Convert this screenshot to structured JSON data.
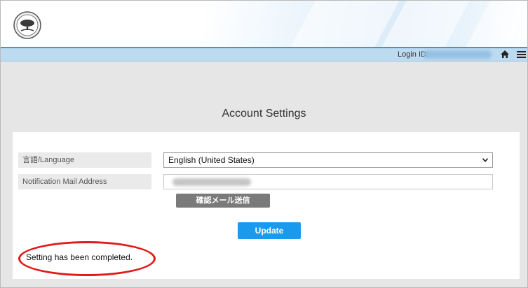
{
  "header": {
    "login_label": "Login ID:"
  },
  "page": {
    "title": "Account Settings"
  },
  "form": {
    "language_label": "言語/Language",
    "language_value": "English (United States)",
    "email_label": "Notification Mail Address",
    "send_confirmation_label": "確認メール送信",
    "update_label": "Update",
    "status_message": "Setting has been completed."
  },
  "colors": {
    "accent_blue": "#1a9aef",
    "header_strip": "#2f9be0",
    "highlight_red": "#e31919"
  },
  "icons": {
    "logo": "seal-logo-icon",
    "home": "home-icon",
    "menu": "hamburger-menu-icon"
  }
}
